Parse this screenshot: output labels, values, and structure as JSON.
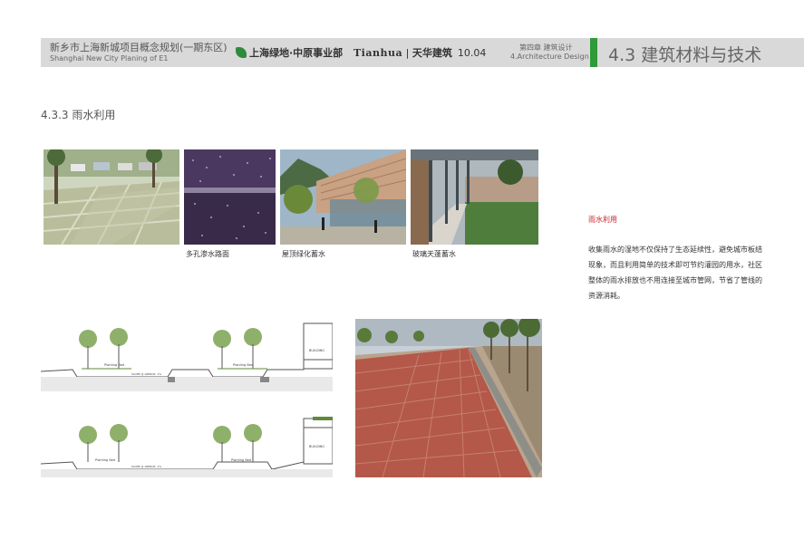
{
  "header": {
    "title_cn": "新乡市上海新城项目概念规划(一期东区)",
    "title_en": "Shanghai New City Planing of E1",
    "logo1": "上海绿地·中原事业部",
    "logo2_en": "Tianhua",
    "logo2_cn": "天华建筑",
    "date": "10.04",
    "chapter_cn": "第四章  建筑设计",
    "chapter_en": "4.Architecture Design",
    "section": "4.3 建筑材料与技术"
  },
  "subheading": "4.3.3 雨水利用",
  "captions": {
    "photo2": "多孔渗水路面",
    "photo3": "屋顶绿化蓄水",
    "photo4": "玻璃天蓬蓄水"
  },
  "diagram_labels": {
    "planting_bed": "Planting Bed",
    "building": "BUILDING",
    "slope": "SLOPE @ APPROX. 1%"
  },
  "sidebar": {
    "title": "雨水利用",
    "body": "收集雨水的湿地不仅保持了生态延续性，避免城市板结现象，而且利用简单的技术即可节约灌园的用水，社区整体的雨水排放也不用连接至城市管网，节省了管线的资源消耗。"
  },
  "colors": {
    "header_bg": "#d9d9d9",
    "accent_green": "#2e9a3a",
    "title_red": "#c0282d"
  }
}
